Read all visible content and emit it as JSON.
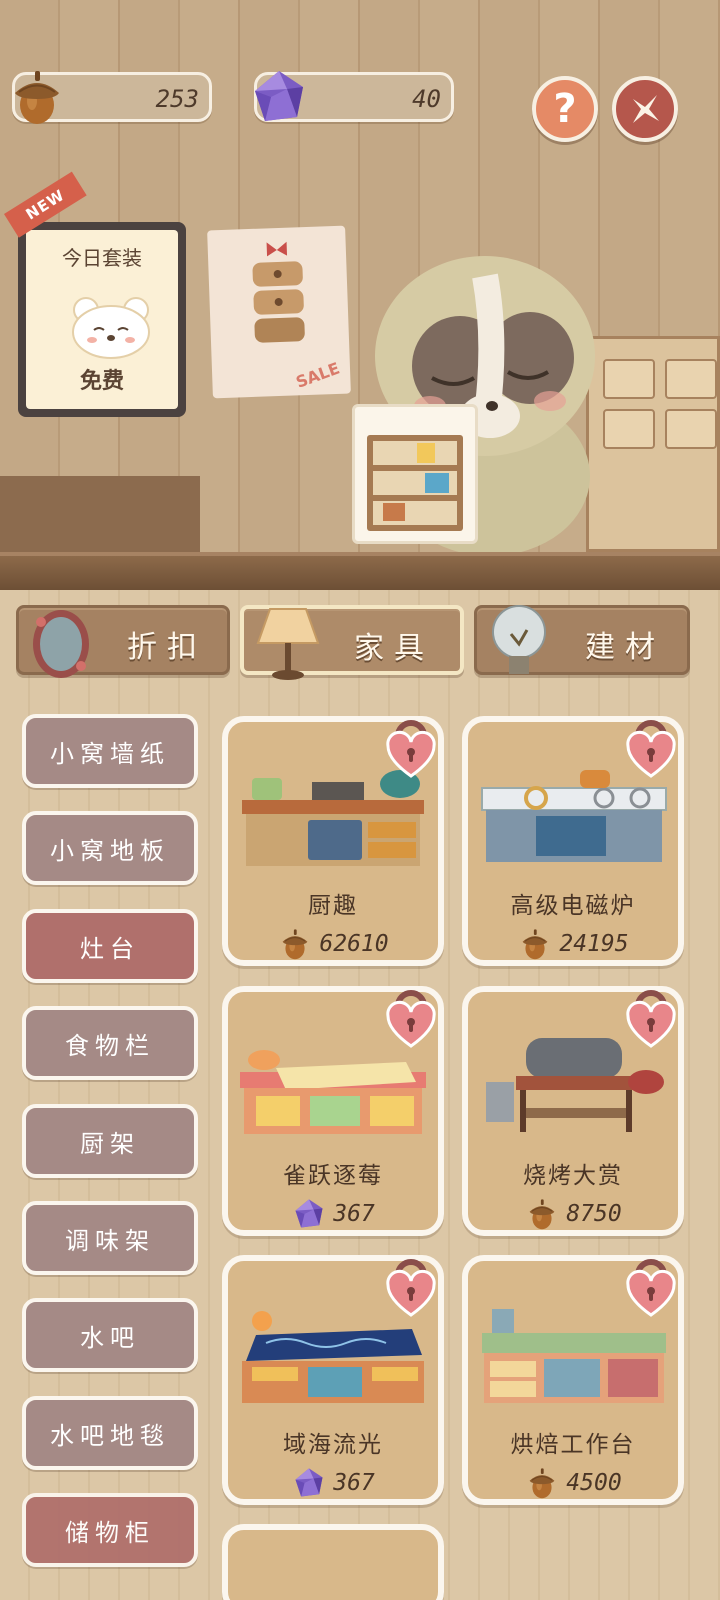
{
  "currencies": {
    "acorn": {
      "value": "253",
      "icon": "acorn-icon"
    },
    "gem": {
      "value": "40",
      "icon": "purple-gem-icon"
    }
  },
  "header_buttons": {
    "help_label": "?",
    "help_icon": "question-icon",
    "close_icon": "close-x-icon"
  },
  "scene": {
    "new_badge": "NEW",
    "board_title": "今日套装",
    "board_free": "免费",
    "poster_sale": "SALE"
  },
  "category_tabs": [
    {
      "label": "折扣",
      "icon": "mirror-icon",
      "active": false
    },
    {
      "label": "家具",
      "icon": "lamp-icon",
      "active": true
    },
    {
      "label": "建材",
      "icon": "lightbulb-icon",
      "active": false
    }
  ],
  "sidebar": {
    "items": [
      {
        "label": "小窝墙纸",
        "active": false
      },
      {
        "label": "小窝地板",
        "active": false
      },
      {
        "label": "灶台",
        "active": true
      },
      {
        "label": "食物栏",
        "active": false
      },
      {
        "label": "厨架",
        "active": false
      },
      {
        "label": "调味架",
        "active": false
      },
      {
        "label": "水吧",
        "active": false
      },
      {
        "label": "水吧地毯",
        "active": false
      },
      {
        "label": "储物柜",
        "active": false
      }
    ]
  },
  "products": [
    {
      "name": "厨趣",
      "price": "62610",
      "currency": "acorn",
      "locked": true
    },
    {
      "name": "高级电磁炉",
      "price": "24195",
      "currency": "acorn",
      "locked": true
    },
    {
      "name": "雀跃逐莓",
      "price": "367",
      "currency": "gem",
      "locked": true
    },
    {
      "name": "烧烤大赏",
      "price": "8750",
      "currency": "acorn",
      "locked": true
    },
    {
      "name": "域海流光",
      "price": "367",
      "currency": "gem",
      "locked": true
    },
    {
      "name": "烘焙工作台",
      "price": "4500",
      "currency": "acorn",
      "locked": true
    }
  ],
  "colors": {
    "sidebar_item": "#a58a86",
    "sidebar_active": "#b0706c",
    "card_bg": "#d8b88a",
    "accent_help": "#e58a66",
    "accent_close": "#b5574c"
  }
}
